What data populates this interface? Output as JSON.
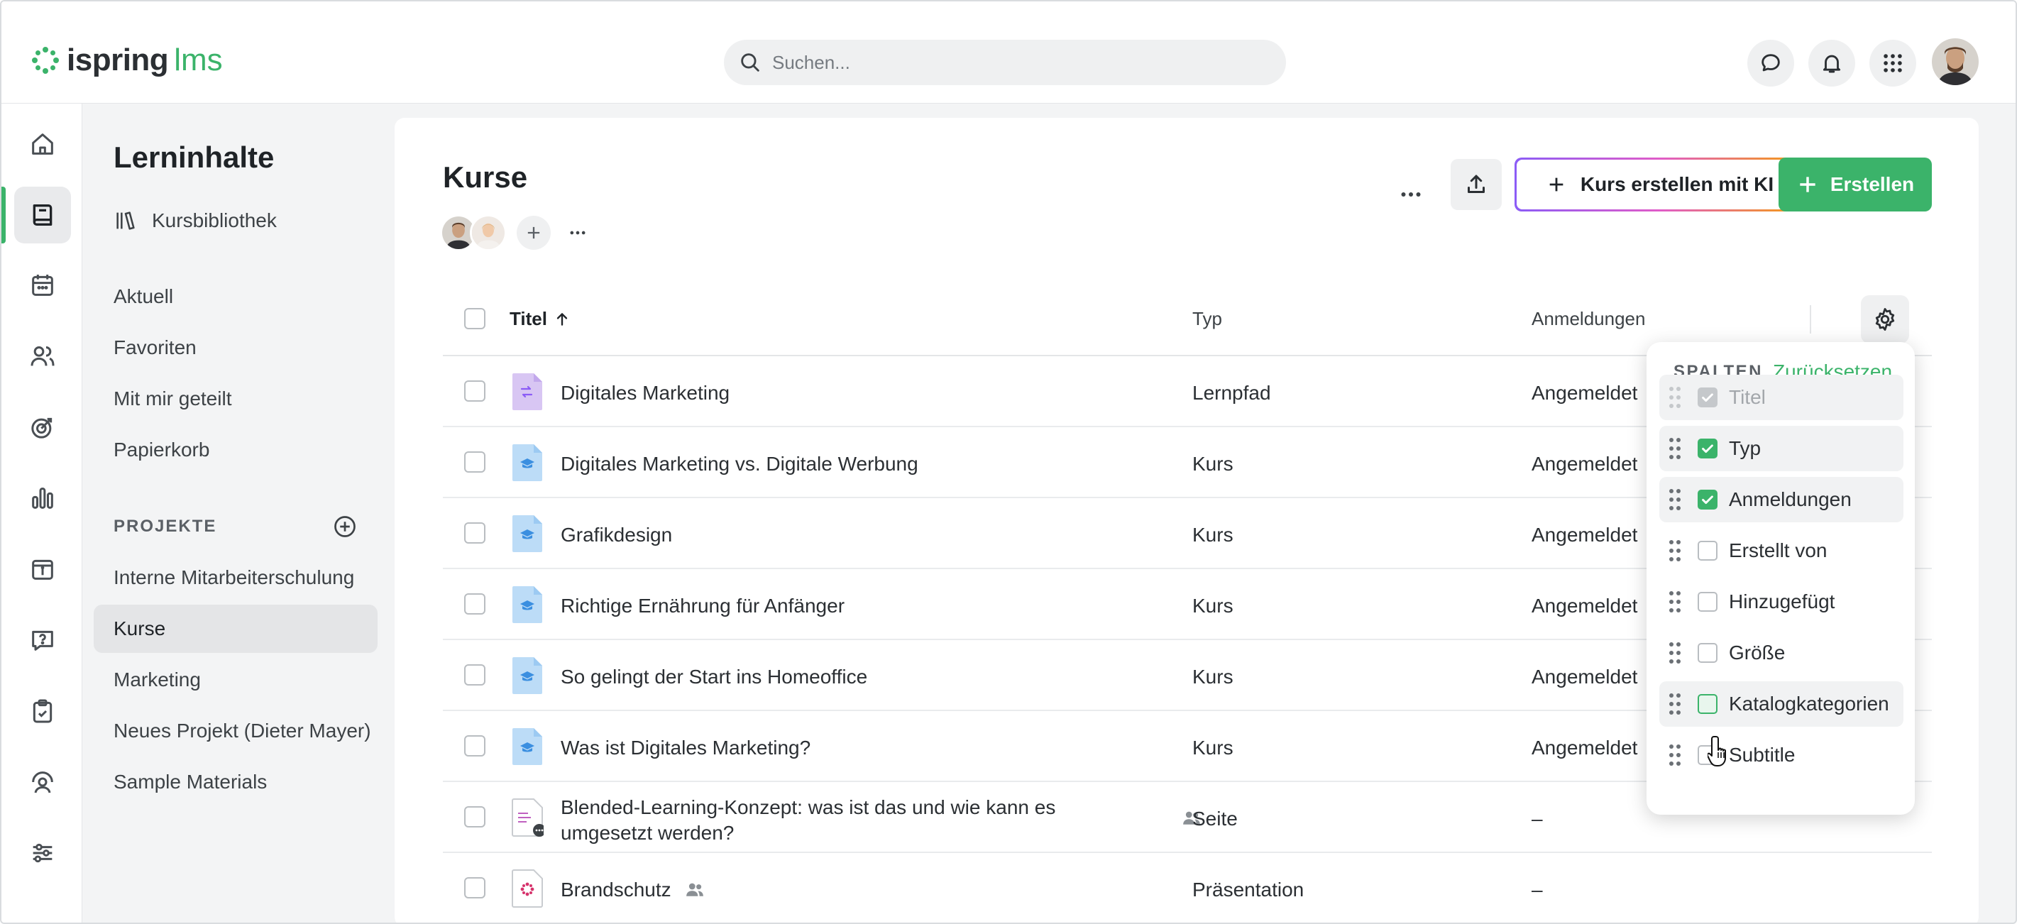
{
  "app": {
    "logo_word": "ispring",
    "logo_suffix": "lms"
  },
  "search": {
    "placeholder": "Suchen..."
  },
  "sidebar_title": "Lerninhalte",
  "library_label": "Kursbibliothek",
  "nav_links": [
    "Aktuell",
    "Favoriten",
    "Mit mir geteilt",
    "Papierkorb"
  ],
  "projects_label": "PROJEKTE",
  "projects": [
    "Interne Mitarbeiterschulung",
    "Kurse",
    "Marketing",
    "Neues Projekt (Dieter Mayer)",
    "Sample Materials"
  ],
  "active_project": "Kurse",
  "page_title": "Kurse",
  "buttons": {
    "ai": "Kurs erstellen mit KI",
    "create": "Erstellen"
  },
  "columns": {
    "title": "Titel",
    "type": "Typ",
    "enrollments": "Anmeldungen"
  },
  "rows": [
    {
      "title": "Digitales Marketing",
      "type": "Lernpfad",
      "enrollment": "Angemeldet",
      "icon": "learning-path-icon"
    },
    {
      "title": "Digitales Marketing vs. Digitale Werbung",
      "type": "Kurs",
      "enrollment": "Angemeldet",
      "icon": "course-icon"
    },
    {
      "title": "Grafikdesign",
      "type": "Kurs",
      "enrollment": "Angemeldet",
      "icon": "course-icon"
    },
    {
      "title": "Richtige Ernährung für Anfänger",
      "type": "Kurs",
      "enrollment": "Angemeldet",
      "icon": "course-icon"
    },
    {
      "title": "So gelingt der Start ins Homeoffice",
      "type": "Kurs",
      "enrollment": "Angemeldet",
      "icon": "course-icon"
    },
    {
      "title": "Was ist Digitales Marketing?",
      "type": "Kurs",
      "enrollment": "Angemeldet",
      "icon": "course-icon"
    },
    {
      "title": "Blended-Learning-Konzept: was ist das und wie kann es umgesetzt werden?",
      "type": "Seite",
      "enrollment": "–",
      "icon": "page-icon"
    },
    {
      "title": "Brandschutz",
      "type": "Präsentation",
      "enrollment": "–",
      "icon": "presentation-icon"
    }
  ],
  "column_popup": {
    "heading": "SPALTEN",
    "reset": "Zurücksetzen",
    "items": [
      {
        "label": "Titel",
        "checked": true,
        "disabled": true
      },
      {
        "label": "Typ",
        "checked": true,
        "disabled": false
      },
      {
        "label": "Anmeldungen",
        "checked": true,
        "disabled": false
      },
      {
        "label": "Erstellt von",
        "checked": false,
        "disabled": false
      },
      {
        "label": "Hinzugefügt",
        "checked": false,
        "disabled": false
      },
      {
        "label": "Größe",
        "checked": false,
        "disabled": false
      },
      {
        "label": "Katalogkategorien",
        "checked": false,
        "disabled": false
      },
      {
        "label": "Subtitle",
        "checked": false,
        "disabled": false
      }
    ]
  },
  "colors": {
    "accent": "#3bb36a",
    "course_icon": "#bcdcf7",
    "path_icon": "#d8c6f3"
  }
}
